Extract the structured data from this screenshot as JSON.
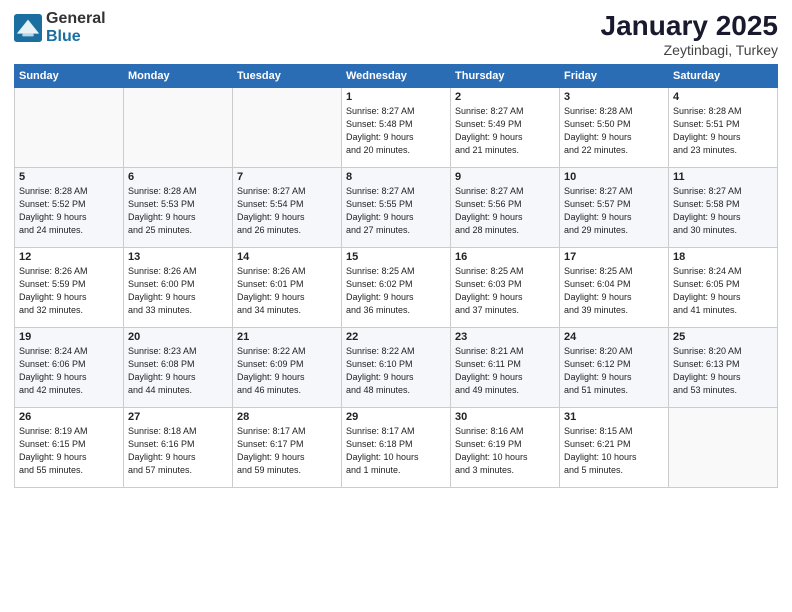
{
  "logo": {
    "general": "General",
    "blue": "Blue"
  },
  "title": "January 2025",
  "subtitle": "Zeytinbagi, Turkey",
  "days_of_week": [
    "Sunday",
    "Monday",
    "Tuesday",
    "Wednesday",
    "Thursday",
    "Friday",
    "Saturday"
  ],
  "weeks": [
    {
      "days": [
        {
          "num": "",
          "info": ""
        },
        {
          "num": "",
          "info": ""
        },
        {
          "num": "",
          "info": ""
        },
        {
          "num": "1",
          "info": "Sunrise: 8:27 AM\nSunset: 5:48 PM\nDaylight: 9 hours\nand 20 minutes."
        },
        {
          "num": "2",
          "info": "Sunrise: 8:27 AM\nSunset: 5:49 PM\nDaylight: 9 hours\nand 21 minutes."
        },
        {
          "num": "3",
          "info": "Sunrise: 8:28 AM\nSunset: 5:50 PM\nDaylight: 9 hours\nand 22 minutes."
        },
        {
          "num": "4",
          "info": "Sunrise: 8:28 AM\nSunset: 5:51 PM\nDaylight: 9 hours\nand 23 minutes."
        }
      ]
    },
    {
      "days": [
        {
          "num": "5",
          "info": "Sunrise: 8:28 AM\nSunset: 5:52 PM\nDaylight: 9 hours\nand 24 minutes."
        },
        {
          "num": "6",
          "info": "Sunrise: 8:28 AM\nSunset: 5:53 PM\nDaylight: 9 hours\nand 25 minutes."
        },
        {
          "num": "7",
          "info": "Sunrise: 8:27 AM\nSunset: 5:54 PM\nDaylight: 9 hours\nand 26 minutes."
        },
        {
          "num": "8",
          "info": "Sunrise: 8:27 AM\nSunset: 5:55 PM\nDaylight: 9 hours\nand 27 minutes."
        },
        {
          "num": "9",
          "info": "Sunrise: 8:27 AM\nSunset: 5:56 PM\nDaylight: 9 hours\nand 28 minutes."
        },
        {
          "num": "10",
          "info": "Sunrise: 8:27 AM\nSunset: 5:57 PM\nDaylight: 9 hours\nand 29 minutes."
        },
        {
          "num": "11",
          "info": "Sunrise: 8:27 AM\nSunset: 5:58 PM\nDaylight: 9 hours\nand 30 minutes."
        }
      ]
    },
    {
      "days": [
        {
          "num": "12",
          "info": "Sunrise: 8:26 AM\nSunset: 5:59 PM\nDaylight: 9 hours\nand 32 minutes."
        },
        {
          "num": "13",
          "info": "Sunrise: 8:26 AM\nSunset: 6:00 PM\nDaylight: 9 hours\nand 33 minutes."
        },
        {
          "num": "14",
          "info": "Sunrise: 8:26 AM\nSunset: 6:01 PM\nDaylight: 9 hours\nand 34 minutes."
        },
        {
          "num": "15",
          "info": "Sunrise: 8:25 AM\nSunset: 6:02 PM\nDaylight: 9 hours\nand 36 minutes."
        },
        {
          "num": "16",
          "info": "Sunrise: 8:25 AM\nSunset: 6:03 PM\nDaylight: 9 hours\nand 37 minutes."
        },
        {
          "num": "17",
          "info": "Sunrise: 8:25 AM\nSunset: 6:04 PM\nDaylight: 9 hours\nand 39 minutes."
        },
        {
          "num": "18",
          "info": "Sunrise: 8:24 AM\nSunset: 6:05 PM\nDaylight: 9 hours\nand 41 minutes."
        }
      ]
    },
    {
      "days": [
        {
          "num": "19",
          "info": "Sunrise: 8:24 AM\nSunset: 6:06 PM\nDaylight: 9 hours\nand 42 minutes."
        },
        {
          "num": "20",
          "info": "Sunrise: 8:23 AM\nSunset: 6:08 PM\nDaylight: 9 hours\nand 44 minutes."
        },
        {
          "num": "21",
          "info": "Sunrise: 8:22 AM\nSunset: 6:09 PM\nDaylight: 9 hours\nand 46 minutes."
        },
        {
          "num": "22",
          "info": "Sunrise: 8:22 AM\nSunset: 6:10 PM\nDaylight: 9 hours\nand 48 minutes."
        },
        {
          "num": "23",
          "info": "Sunrise: 8:21 AM\nSunset: 6:11 PM\nDaylight: 9 hours\nand 49 minutes."
        },
        {
          "num": "24",
          "info": "Sunrise: 8:20 AM\nSunset: 6:12 PM\nDaylight: 9 hours\nand 51 minutes."
        },
        {
          "num": "25",
          "info": "Sunrise: 8:20 AM\nSunset: 6:13 PM\nDaylight: 9 hours\nand 53 minutes."
        }
      ]
    },
    {
      "days": [
        {
          "num": "26",
          "info": "Sunrise: 8:19 AM\nSunset: 6:15 PM\nDaylight: 9 hours\nand 55 minutes."
        },
        {
          "num": "27",
          "info": "Sunrise: 8:18 AM\nSunset: 6:16 PM\nDaylight: 9 hours\nand 57 minutes."
        },
        {
          "num": "28",
          "info": "Sunrise: 8:17 AM\nSunset: 6:17 PM\nDaylight: 9 hours\nand 59 minutes."
        },
        {
          "num": "29",
          "info": "Sunrise: 8:17 AM\nSunset: 6:18 PM\nDaylight: 10 hours\nand 1 minute."
        },
        {
          "num": "30",
          "info": "Sunrise: 8:16 AM\nSunset: 6:19 PM\nDaylight: 10 hours\nand 3 minutes."
        },
        {
          "num": "31",
          "info": "Sunrise: 8:15 AM\nSunset: 6:21 PM\nDaylight: 10 hours\nand 5 minutes."
        },
        {
          "num": "",
          "info": ""
        }
      ]
    }
  ]
}
